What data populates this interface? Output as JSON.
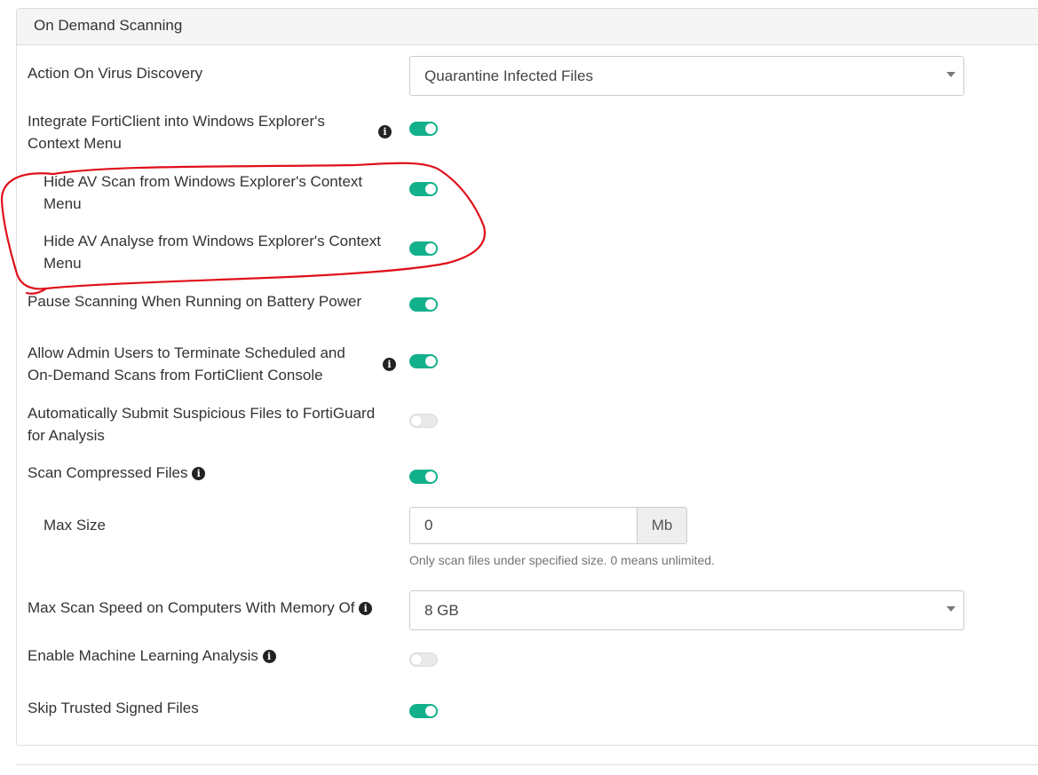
{
  "panel": {
    "title": "On Demand Scanning"
  },
  "settings": {
    "action_on_virus": {
      "label": "Action On Virus Discovery",
      "value": "Quarantine Infected Files"
    },
    "integrate_context_menu": {
      "label": "Integrate FortiClient into Windows Explorer's Context Menu",
      "enabled": true,
      "info_icon": "info-circle-icon"
    },
    "hide_av_scan": {
      "label": "Hide AV Scan from Windows Explorer's Context Menu",
      "enabled": true
    },
    "hide_av_analyse": {
      "label": "Hide AV Analyse from Windows Explorer's Context Menu",
      "enabled": true
    },
    "pause_on_battery": {
      "label": "Pause Scanning When Running on Battery Power",
      "enabled": true
    },
    "allow_admin_terminate": {
      "label": "Allow Admin Users to Terminate Scheduled and On-Demand Scans from FortiClient Console",
      "enabled": true,
      "info_icon": "info-circle-icon"
    },
    "auto_submit": {
      "label": "Automatically Submit Suspicious Files to FortiGuard for Analysis",
      "enabled": false
    },
    "scan_compressed": {
      "label": "Scan Compressed Files",
      "enabled": true,
      "info_icon": "info-circle-icon"
    },
    "max_size": {
      "label": "Max Size",
      "value": "0",
      "unit": "Mb",
      "help": "Only scan files under specified size. 0 means unlimited."
    },
    "max_scan_speed": {
      "label": "Max Scan Speed on Computers With Memory Of",
      "value": "8 GB",
      "info_icon": "info-circle-icon"
    },
    "machine_learning": {
      "label": "Enable Machine Learning Analysis",
      "enabled": false,
      "info_icon": "info-circle-icon"
    },
    "skip_trusted_signed": {
      "label": "Skip Trusted Signed Files",
      "enabled": true
    }
  },
  "info_glyph": "i",
  "colors": {
    "toggle_on": "#13b08c",
    "toggle_off": "#e9e9e9",
    "annotation": "#e0101a",
    "panel_heading_bg": "#f5f5f5"
  }
}
